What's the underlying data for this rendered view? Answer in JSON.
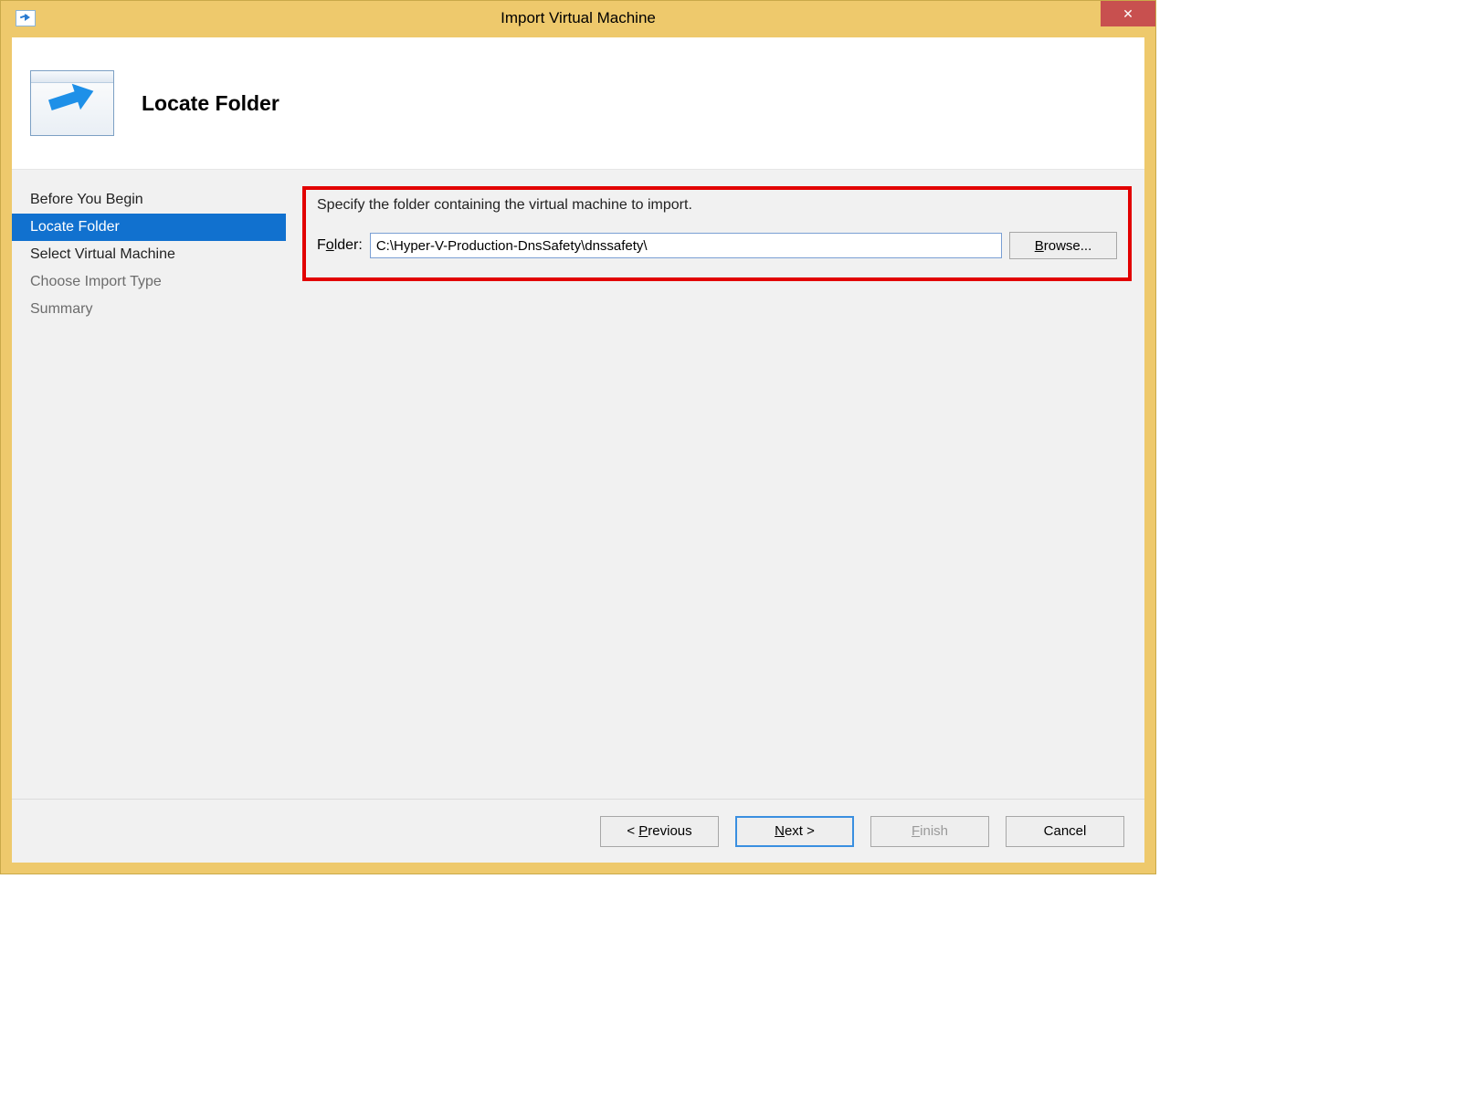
{
  "window": {
    "title": "Import Virtual Machine",
    "close": "✕"
  },
  "header": {
    "title": "Locate Folder"
  },
  "sidebar": {
    "items": [
      {
        "label": "Before You Begin",
        "state": "normal"
      },
      {
        "label": "Locate Folder",
        "state": "selected"
      },
      {
        "label": "Select Virtual Machine",
        "state": "normal"
      },
      {
        "label": "Choose Import Type",
        "state": "disabled"
      },
      {
        "label": "Summary",
        "state": "disabled"
      }
    ]
  },
  "main": {
    "instruction": "Specify the folder containing the virtual machine to import.",
    "folder_label_pre": "F",
    "folder_label_ul": "o",
    "folder_label_post": "lder:",
    "folder_value": "C:\\Hyper-V-Production-DnsSafety\\dnssafety\\",
    "browse_ul": "B",
    "browse_post": "rowse..."
  },
  "footer": {
    "prev_pre": "< ",
    "prev_ul": "P",
    "prev_post": "revious",
    "next_ul": "N",
    "next_post": "ext >",
    "finish_ul": "F",
    "finish_post": "inish",
    "cancel": "Cancel"
  }
}
